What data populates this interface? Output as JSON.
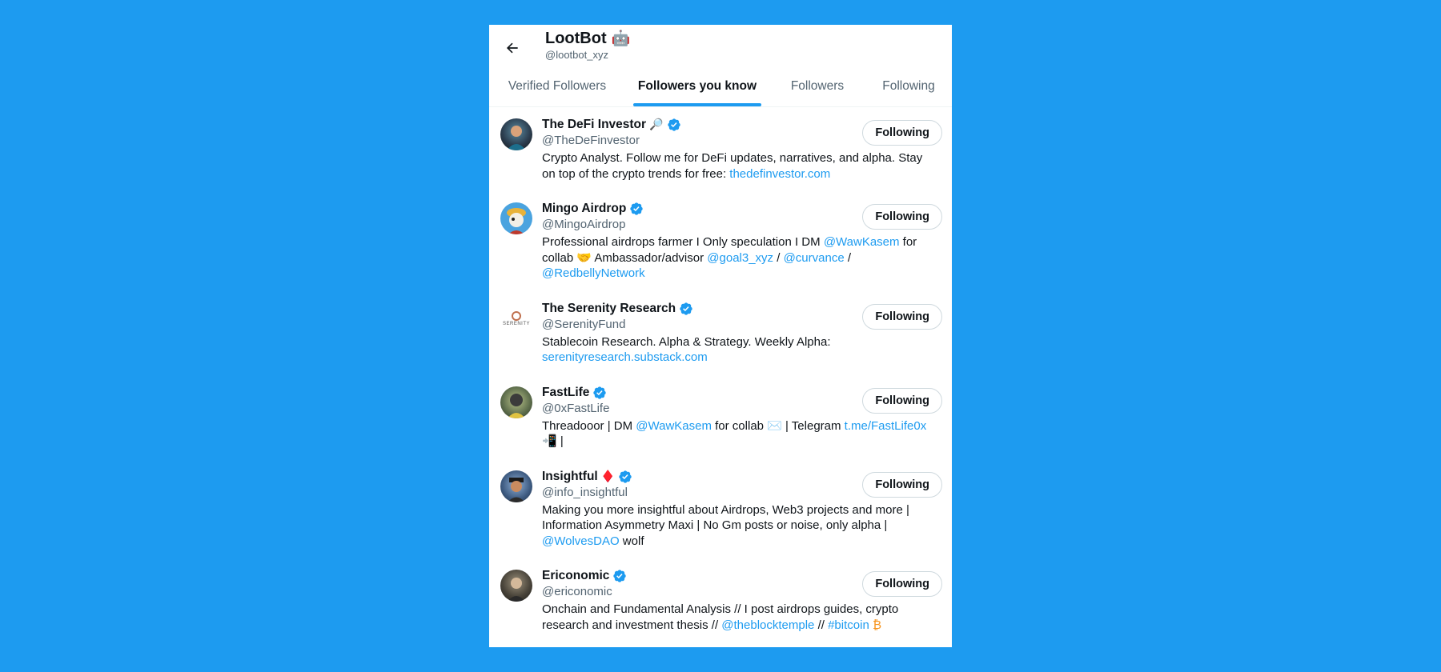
{
  "header": {
    "title": "LootBot",
    "title_emoji": "🤖",
    "handle": "@lootbot_xyz"
  },
  "tabs": [
    {
      "label": "Verified Followers",
      "active": false
    },
    {
      "label": "Followers you know",
      "active": true
    },
    {
      "label": "Followers",
      "active": false
    },
    {
      "label": "Following",
      "active": false
    }
  ],
  "users": [
    {
      "name": "The DeFi Investor",
      "name_suffix": "🔎",
      "handle": "@TheDeFinvestor",
      "button": "Following",
      "bio": [
        {
          "t": "Crypto Analyst. Follow me for DeFi updates, narratives, and alpha. Stay on top of the crypto trends for free: "
        },
        {
          "t": "thedefinvestor.com",
          "link": true
        }
      ]
    },
    {
      "name": "Mingo Airdrop",
      "name_suffix": "",
      "handle": "@MingoAirdrop",
      "button": "Following",
      "bio": [
        {
          "t": "Professional airdrops farmer I Only speculation I DM "
        },
        {
          "t": "@WawKasem",
          "link": true
        },
        {
          "t": " for collab 🤝 Ambassador/advisor "
        },
        {
          "t": "@goal3_xyz",
          "link": true
        },
        {
          "t": " / "
        },
        {
          "t": "@curvance",
          "link": true
        },
        {
          "t": " / "
        },
        {
          "t": "@RedbellyNetwork",
          "link": true
        }
      ]
    },
    {
      "name": "The Serenity Research",
      "name_suffix": "",
      "handle": "@SerenityFund",
      "button": "Following",
      "avatar_text": "SERENITY",
      "bio": [
        {
          "t": "Stablecoin Research. Alpha & Strategy. Weekly Alpha: "
        },
        {
          "t": "serenityresearch.substack.com",
          "link": true
        }
      ]
    },
    {
      "name": "FastLife",
      "name_suffix": "",
      "handle": "@0xFastLife",
      "button": "Following",
      "bio": [
        {
          "t": "Threadooor | DM "
        },
        {
          "t": "@WawKasem",
          "link": true
        },
        {
          "t": " for collab ✉️ | Telegram "
        },
        {
          "t": "t.me/FastLife0x",
          "link": true
        },
        {
          "t": " 📲 |"
        }
      ]
    },
    {
      "name": "Insightful",
      "name_suffix": "♦️",
      "handle": "@info_insightful",
      "button": "Following",
      "bio": [
        {
          "t": "Making you more insightful about Airdrops, Web3 projects and more | Information Asymmetry Maxi | No Gm posts or noise, only alpha | "
        },
        {
          "t": "@WolvesDAO",
          "link": true
        },
        {
          "t": " wolf"
        }
      ]
    },
    {
      "name": "Ericonomic",
      "name_suffix": "",
      "handle": "@ericonomic",
      "button": "Following",
      "bio": [
        {
          "t": "Onchain and Fundamental Analysis // I post airdrops guides, crypto research and investment thesis // "
        },
        {
          "t": "@theblocktemple",
          "link": true
        },
        {
          "t": " // "
        },
        {
          "t": "#bitcoin",
          "link": true
        },
        {
          "t": " ₿"
        }
      ]
    }
  ],
  "colors": {
    "background": "#1d9bf0",
    "accent": "#1d9bf0",
    "text_primary": "#0f1419",
    "text_secondary": "#536471"
  }
}
